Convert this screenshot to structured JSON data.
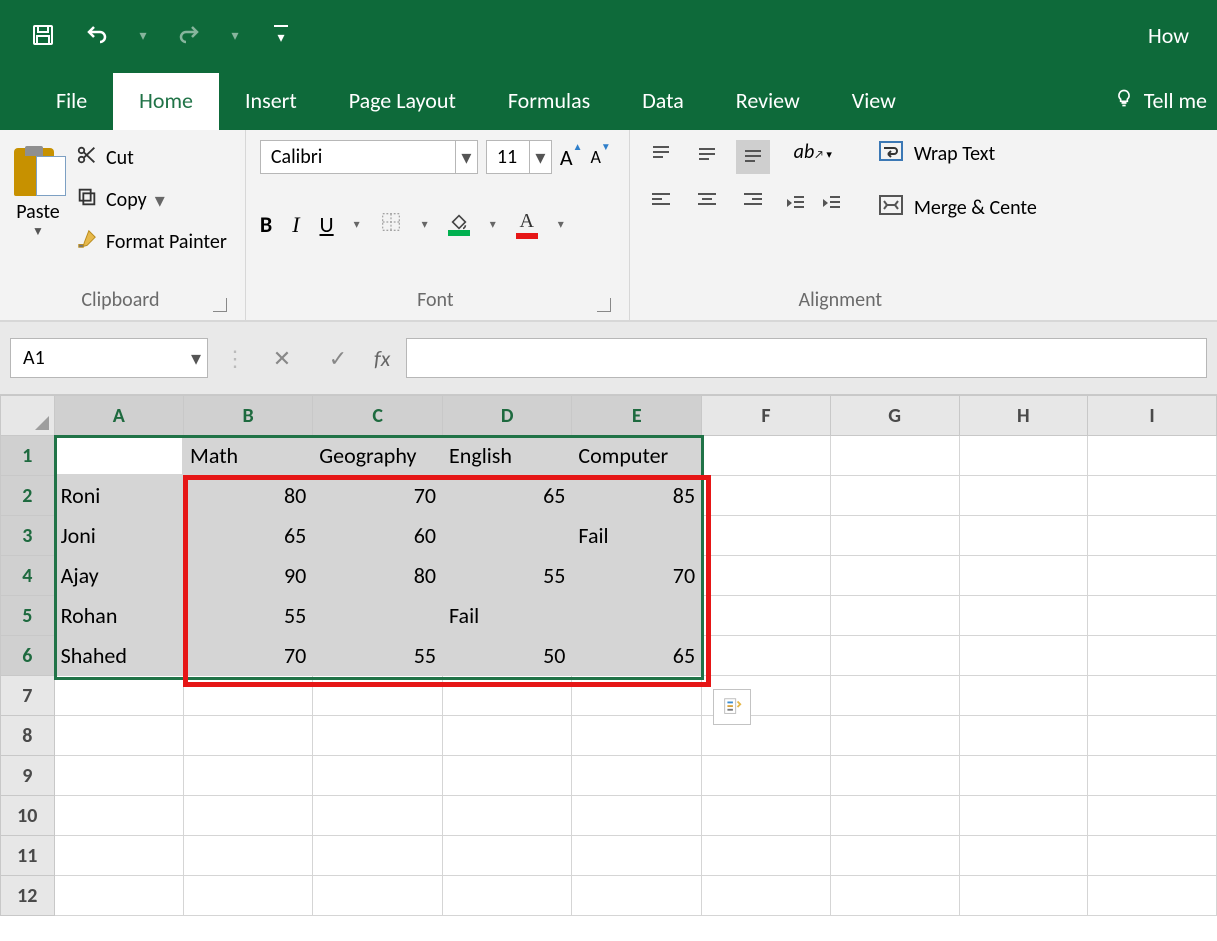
{
  "titlebar": {
    "right_text": "How"
  },
  "tabs": {
    "file": "File",
    "home": "Home",
    "insert": "Insert",
    "page_layout": "Page Layout",
    "formulas": "Formulas",
    "data": "Data",
    "review": "Review",
    "view": "View",
    "tell_me": "Tell me"
  },
  "ribbon": {
    "clipboard": {
      "paste": "Paste",
      "cut": "Cut",
      "copy": "Copy",
      "format_painter": "Format Painter",
      "group_label": "Clipboard"
    },
    "font": {
      "name": "Calibri",
      "size": "11",
      "bold": "B",
      "italic": "I",
      "underline": "U",
      "group_label": "Font",
      "inc_a": "A",
      "dec_a": "A"
    },
    "alignment": {
      "wrap": "Wrap Text",
      "merge": "Merge & Cente",
      "group_label": "Alignment"
    }
  },
  "formula_bar": {
    "name_box": "A1",
    "fx": "fx",
    "formula_value": ""
  },
  "sheet": {
    "col_headers": [
      "A",
      "B",
      "C",
      "D",
      "E",
      "F",
      "G",
      "H",
      "I"
    ],
    "row_headers": [
      "1",
      "2",
      "3",
      "4",
      "5",
      "6",
      "7",
      "8",
      "9",
      "10",
      "11",
      "12"
    ],
    "header_row": [
      "",
      "Math",
      "Geography",
      "English",
      "Computer"
    ],
    "rows": [
      {
        "name": "Roni",
        "vals": [
          "80",
          "70",
          "65",
          "85"
        ]
      },
      {
        "name": "Joni",
        "vals": [
          "65",
          "60",
          "",
          "Fail"
        ]
      },
      {
        "name": "Ajay",
        "vals": [
          "90",
          "80",
          "55",
          "70"
        ]
      },
      {
        "name": "Rohan",
        "vals": [
          "55",
          "",
          "Fail",
          ""
        ]
      },
      {
        "name": "Shahed",
        "vals": [
          "70",
          "55",
          "50",
          "65"
        ]
      }
    ]
  }
}
